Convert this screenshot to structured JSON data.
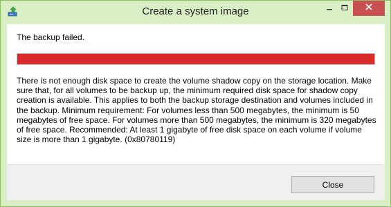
{
  "window": {
    "title": "Create a system image"
  },
  "titlebar_buttons": {
    "minimize_icon": "minimize-icon",
    "maximize_icon": "maximize-icon",
    "close_icon": "close-icon"
  },
  "main": {
    "heading": "The backup failed.",
    "progress_fraction": 1.0,
    "progress_color": "#da2a2a",
    "message": "There is not enough disk space to create the volume shadow copy on the storage location. Make sure that, for all volumes to be backup up, the minimum required disk space for shadow copy creation is available. This applies to both the backup storage destination and volumes included in the backup. Minimum requirement: For volumes less than 500 megabytes, the minimum is 50 megabytes of free space. For volumes more than 500 megabytes, the minimum is 320 megabytes of free space.  Recommended: At least 1 gigabyte of free disk space on each volume if volume size is more than 1 gigabyte. (0x80780119)"
  },
  "footer": {
    "close_label": "Close"
  },
  "colors": {
    "title_bar": "#d9eec4",
    "close_button_bg": "#c75050",
    "desktop": "#7fc241"
  }
}
